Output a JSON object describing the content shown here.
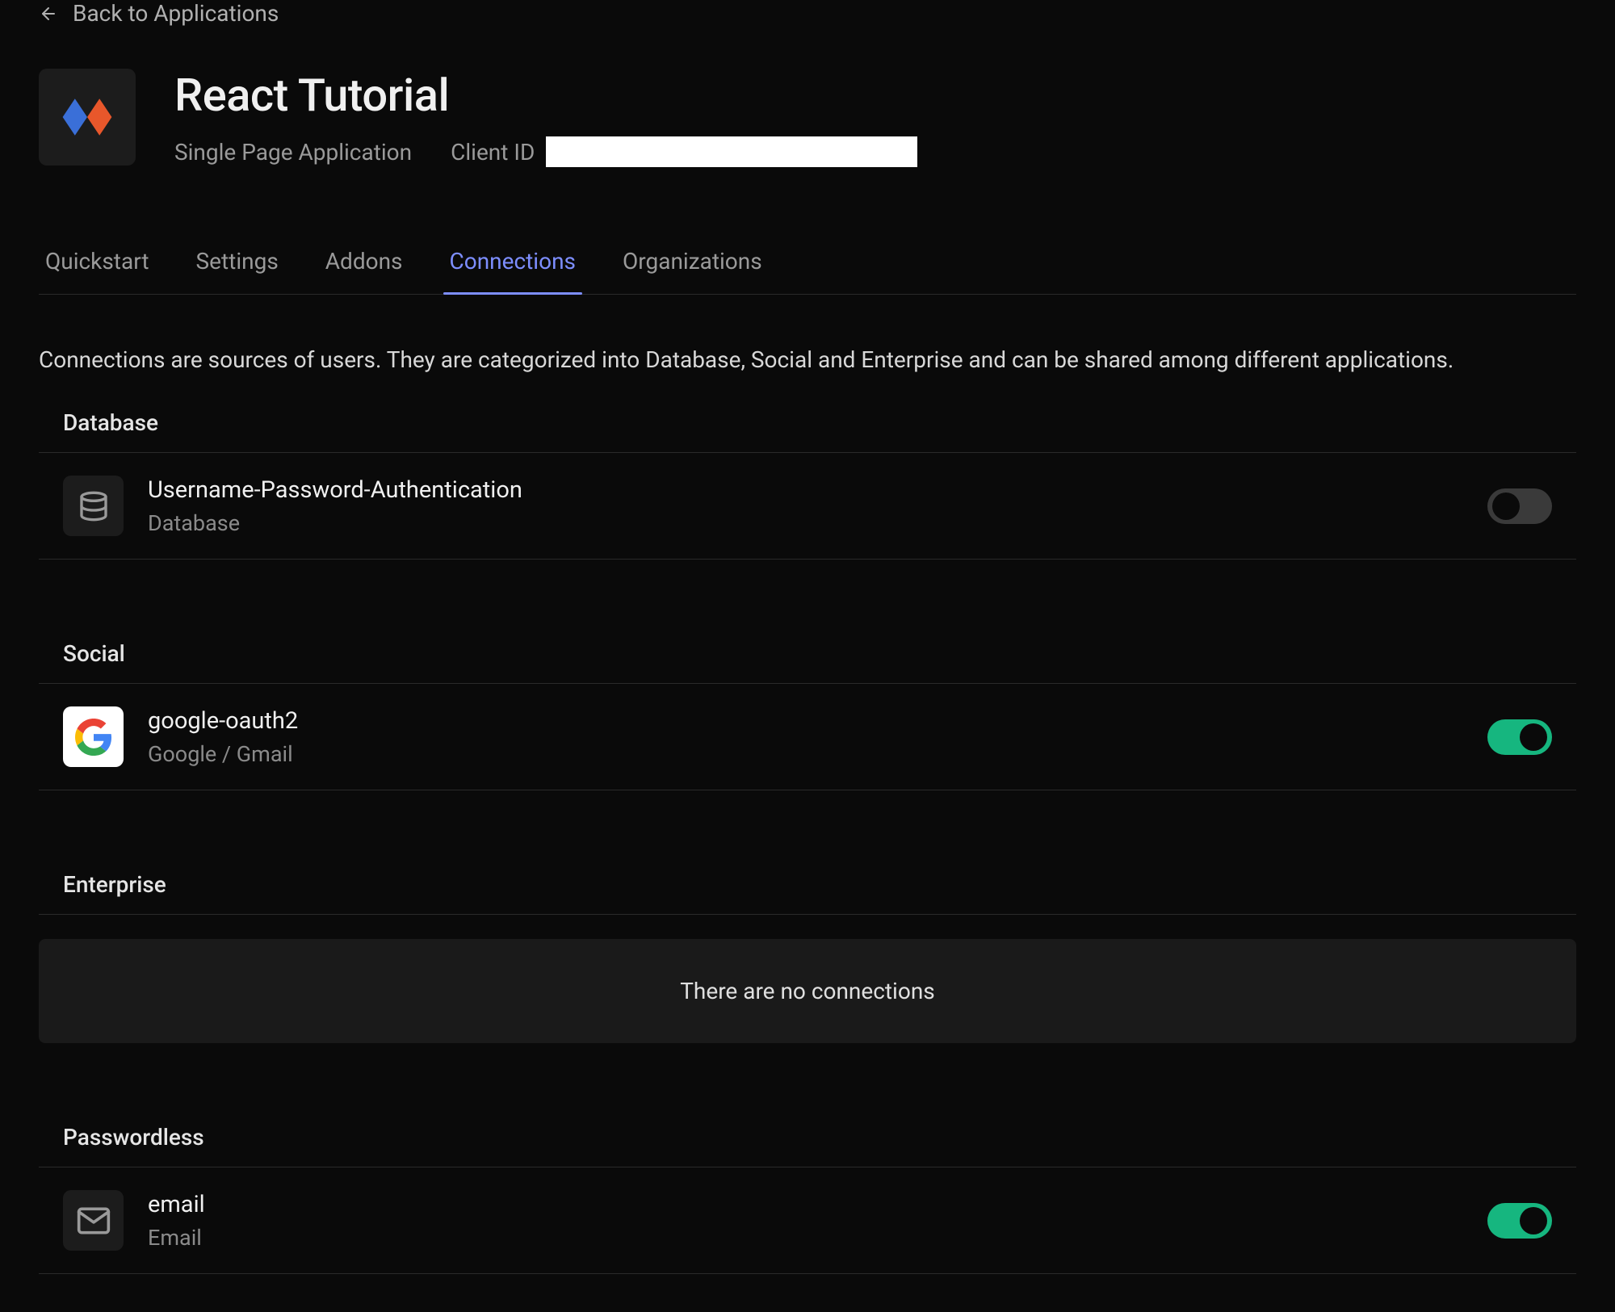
{
  "back": {
    "label": "Back to Applications"
  },
  "app": {
    "title": "React Tutorial",
    "type": "Single Page Application",
    "client_id_label": "Client ID"
  },
  "tabs": [
    {
      "label": "Quickstart",
      "active": false
    },
    {
      "label": "Settings",
      "active": false
    },
    {
      "label": "Addons",
      "active": false
    },
    {
      "label": "Connections",
      "active": true
    },
    {
      "label": "Organizations",
      "active": false
    }
  ],
  "description": "Connections are sources of users. They are categorized into Database, Social and Enterprise and can be shared among different applications.",
  "sections": {
    "database": {
      "title": "Database",
      "items": [
        {
          "name": "Username-Password-Authentication",
          "sub": "Database",
          "enabled": false,
          "icon": "database-icon"
        }
      ]
    },
    "social": {
      "title": "Social",
      "items": [
        {
          "name": "google-oauth2",
          "sub": "Google / Gmail",
          "enabled": true,
          "icon": "google-icon"
        }
      ]
    },
    "enterprise": {
      "title": "Enterprise",
      "empty_text": "There are no connections"
    },
    "passwordless": {
      "title": "Passwordless",
      "items": [
        {
          "name": "email",
          "sub": "Email",
          "enabled": true,
          "icon": "mail-icon"
        }
      ]
    }
  }
}
